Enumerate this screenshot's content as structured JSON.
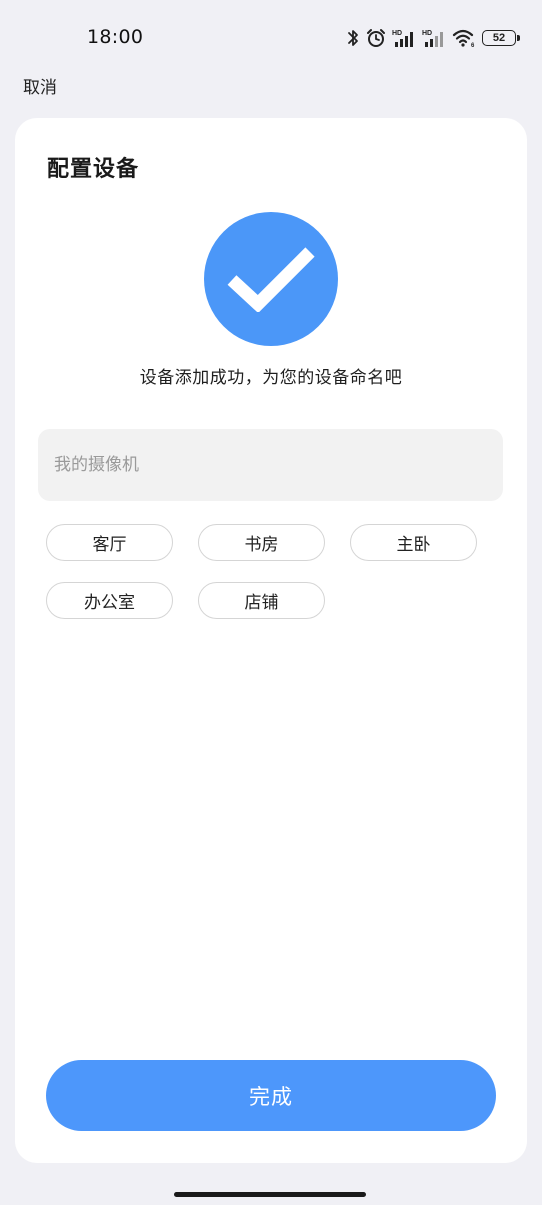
{
  "status_bar": {
    "time": "18:00",
    "battery_level": "52",
    "icons": [
      "bluetooth-icon",
      "alarm-icon",
      "hd-signal-icon",
      "hd-signal-icon",
      "wifi-icon",
      "battery-icon"
    ]
  },
  "header": {
    "cancel_label": "取消"
  },
  "card": {
    "title": "配置设备",
    "success_icon": "checkmark-icon",
    "success_message": "设备添加成功，为您的设备命名吧",
    "name_input": {
      "placeholder": "我的摄像机",
      "value": ""
    },
    "name_suggestions": [
      "客厅",
      "书房",
      "主卧",
      "办公室",
      "店铺"
    ],
    "done_label": "完成"
  },
  "colors": {
    "accent": "#4d97fb",
    "background": "#f0f0f5",
    "card": "#ffffff"
  }
}
